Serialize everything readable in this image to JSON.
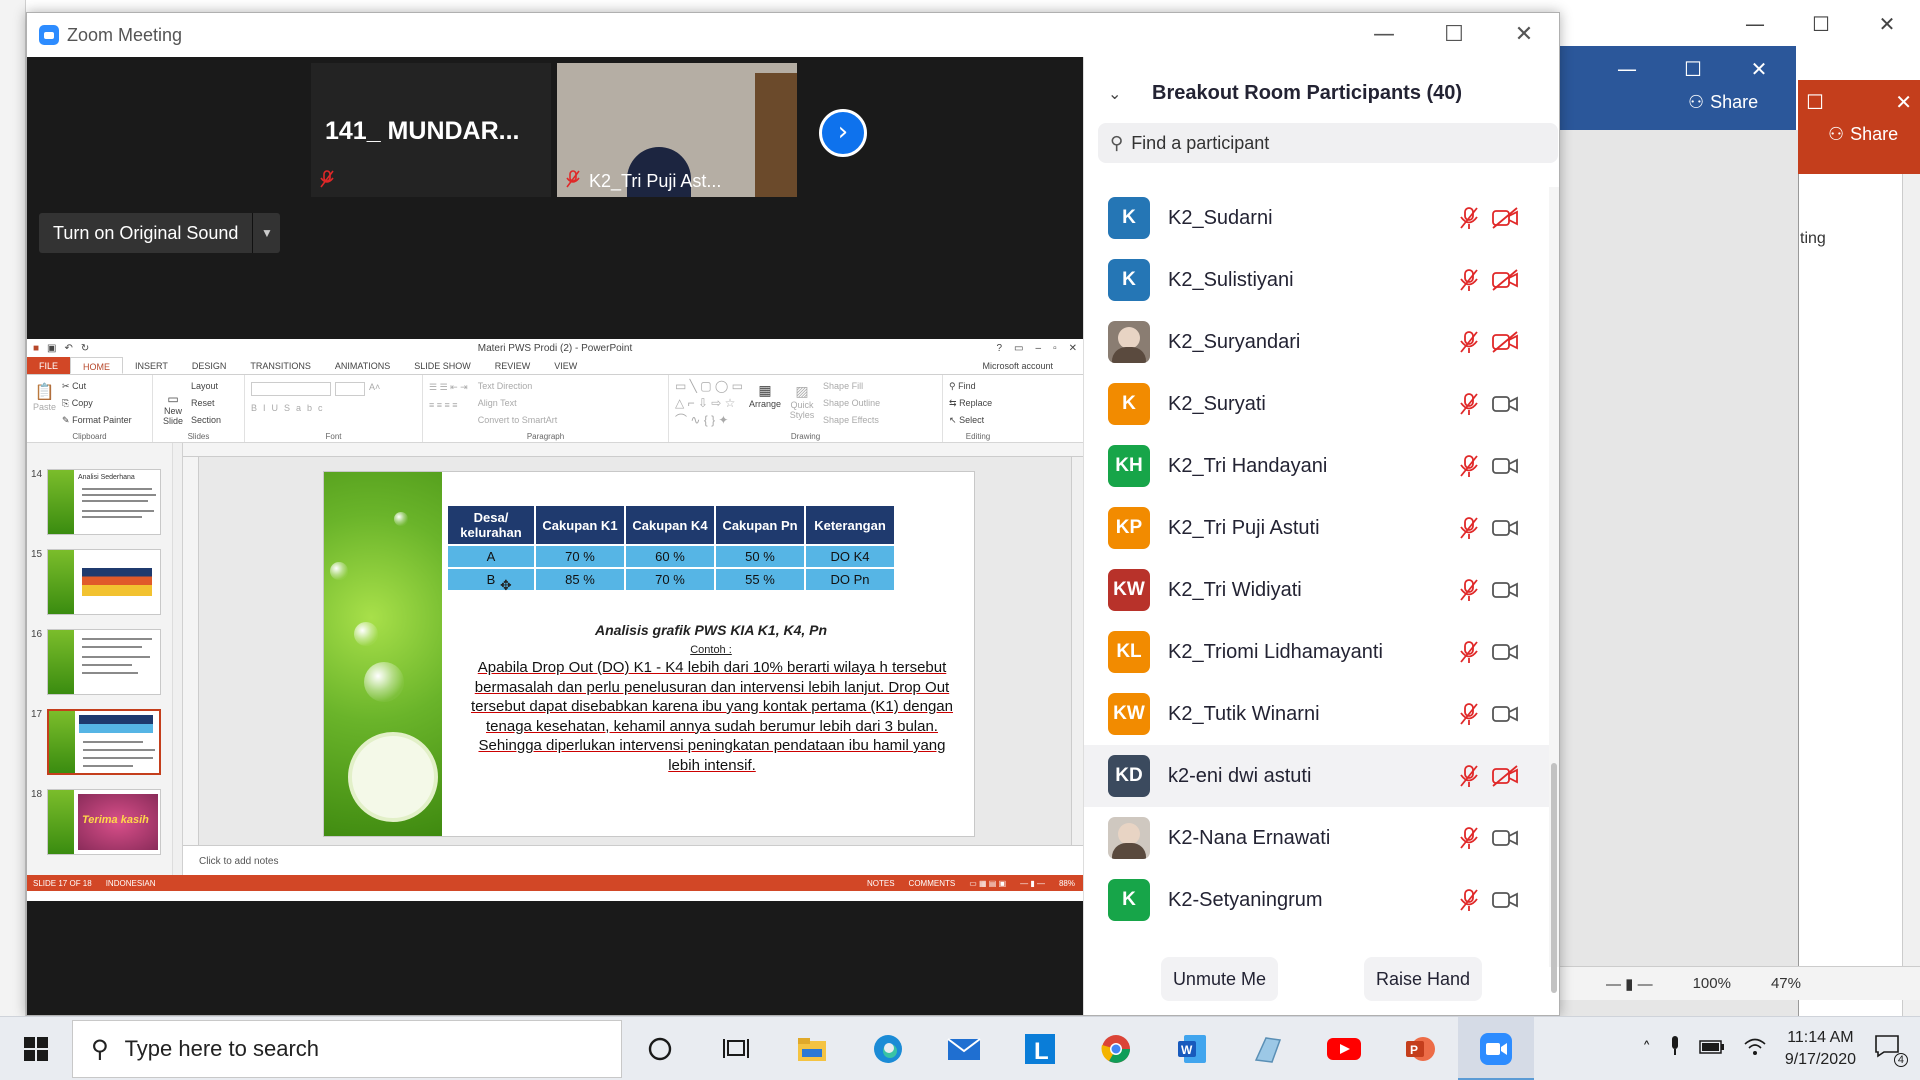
{
  "zoom": {
    "window_title": "Zoom Meeting",
    "video_thumbs": [
      {
        "name": "141_ MUNDAR..."
      },
      {
        "name": "K2_Tri Puji Ast..."
      }
    ],
    "original_sound_label": "Turn on Original Sound"
  },
  "background": {
    "share_label": "Share",
    "share_label2": "Share",
    "partial_text": "ting",
    "zoom_percent": "100%",
    "zoom_percent2": "47%"
  },
  "ppt": {
    "title": "Materi PWS Prodi (2) - PowerPoint",
    "tabs": [
      "FILE",
      "HOME",
      "INSERT",
      "DESIGN",
      "TRANSITIONS",
      "ANIMATIONS",
      "SLIDE SHOW",
      "REVIEW",
      "VIEW"
    ],
    "account": "Microsoft account",
    "ribbon": {
      "clipboard": {
        "paste": "Paste",
        "cut": "Cut",
        "copy": "Copy",
        "format_painter": "Format Painter",
        "name": "Clipboard"
      },
      "slides": {
        "new_slide": "New Slide",
        "layout": "Layout",
        "reset": "Reset",
        "section": "Section",
        "name": "Slides"
      },
      "font": {
        "name": "Font"
      },
      "paragraph": {
        "text_direction": "Text Direction",
        "align_text": "Align Text",
        "convert": "Convert to SmartArt",
        "name": "Paragraph"
      },
      "drawing": {
        "arrange": "Arrange",
        "quick_styles": "Quick Styles",
        "shape_fill": "Shape Fill",
        "shape_outline": "Shape Outline",
        "shape_effects": "Shape Effects",
        "name": "Drawing"
      },
      "editing": {
        "find": "Find",
        "replace": "Replace",
        "select": "Select",
        "name": "Editing"
      }
    },
    "slide_numbers": [
      "14",
      "15",
      "16",
      "17",
      "18"
    ],
    "thumb14_title": "Analisi Sederhana",
    "thumb18_text": "Terima kasih",
    "slide": {
      "table_headers": [
        "Desa/ kelurahan",
        "Cakupan K1",
        "Cakupan K4",
        "Cakupan Pn",
        "Keterangan"
      ],
      "table_rows": [
        [
          "A",
          "70 %",
          "60 %",
          "50 %",
          "DO K4"
        ],
        [
          "B",
          "85 %",
          "70 %",
          "55 %",
          "DO Pn"
        ]
      ],
      "heading": "Analisis grafik PWS KIA K1, K4, Pn",
      "contoh": "Contoh :",
      "body": "Apabila Drop Out (DO) K1 - K4 lebih dari 10% berarti wilaya h tersebut bermasalah dan perlu penelusuran dan intervensi lebih lanjut. Drop Out tersebut dapat disebabkan karena ibu yang kontak pertama (K1) dengan tenaga kesehatan, kehamil annya sudah berumur lebih dari 3 bulan. Sehingga diperlukan intervensi peningkatan pendataan ibu hamil yang lebih intensif."
    },
    "notes_placeholder": "Click to add notes",
    "status": {
      "slide": "SLIDE 17 OF 18",
      "language": "INDONESIAN",
      "notes": "NOTES",
      "comments": "COMMENTS",
      "zoom": "88%"
    }
  },
  "panel": {
    "title": "Breakout Room Participants (40)",
    "search_placeholder": "Find a participant",
    "participants": [
      {
        "initials": "K",
        "name": "K2_Sudarni",
        "color": "#2576b5",
        "video_off": true,
        "photo": false
      },
      {
        "initials": "K",
        "name": "K2_Sulistiyani",
        "color": "#2576b5",
        "video_off": true,
        "photo": false
      },
      {
        "initials": "",
        "name": "K2_Suryandari",
        "color": "#8a7d72",
        "video_off": true,
        "photo": true
      },
      {
        "initials": "K",
        "name": "K2_Suryati",
        "color": "#f28b00",
        "video_off": false,
        "photo": false
      },
      {
        "initials": "KH",
        "name": "K2_Tri Handayani",
        "color": "#17a549",
        "video_off": false,
        "photo": false
      },
      {
        "initials": "KP",
        "name": "K2_Tri Puji Astuti",
        "color": "#f28b00",
        "video_off": false,
        "photo": false
      },
      {
        "initials": "KW",
        "name": "K2_Tri Widiyati",
        "color": "#b8322a",
        "video_off": false,
        "photo": false
      },
      {
        "initials": "KL",
        "name": "K2_Triomi Lidhamayanti",
        "color": "#f28b00",
        "video_off": false,
        "photo": false
      },
      {
        "initials": "KW",
        "name": "K2_Tutik Winarni",
        "color": "#f28b00",
        "video_off": false,
        "photo": false
      },
      {
        "initials": "KD",
        "name": "k2-eni dwi astuti",
        "color": "#3b4a5e",
        "video_off": true,
        "photo": false
      },
      {
        "initials": "",
        "name": "K2-Nana Ernawati",
        "color": "#cfc8c0",
        "video_off": false,
        "photo": true
      },
      {
        "initials": "K",
        "name": "K2-Setyaningrum",
        "color": "#17a549",
        "video_off": false,
        "photo": false
      }
    ],
    "unmute_label": "Unmute Me",
    "raise_hand_label": "Raise Hand"
  },
  "taskbar": {
    "search_placeholder": "Type here to search",
    "time": "11:14 AM",
    "date": "9/17/2020",
    "notification_count": "4"
  },
  "icons": {
    "zoom_blue": "#2d8cff",
    "mute_red": "#e02828",
    "ppt_accent": "#d24726"
  }
}
